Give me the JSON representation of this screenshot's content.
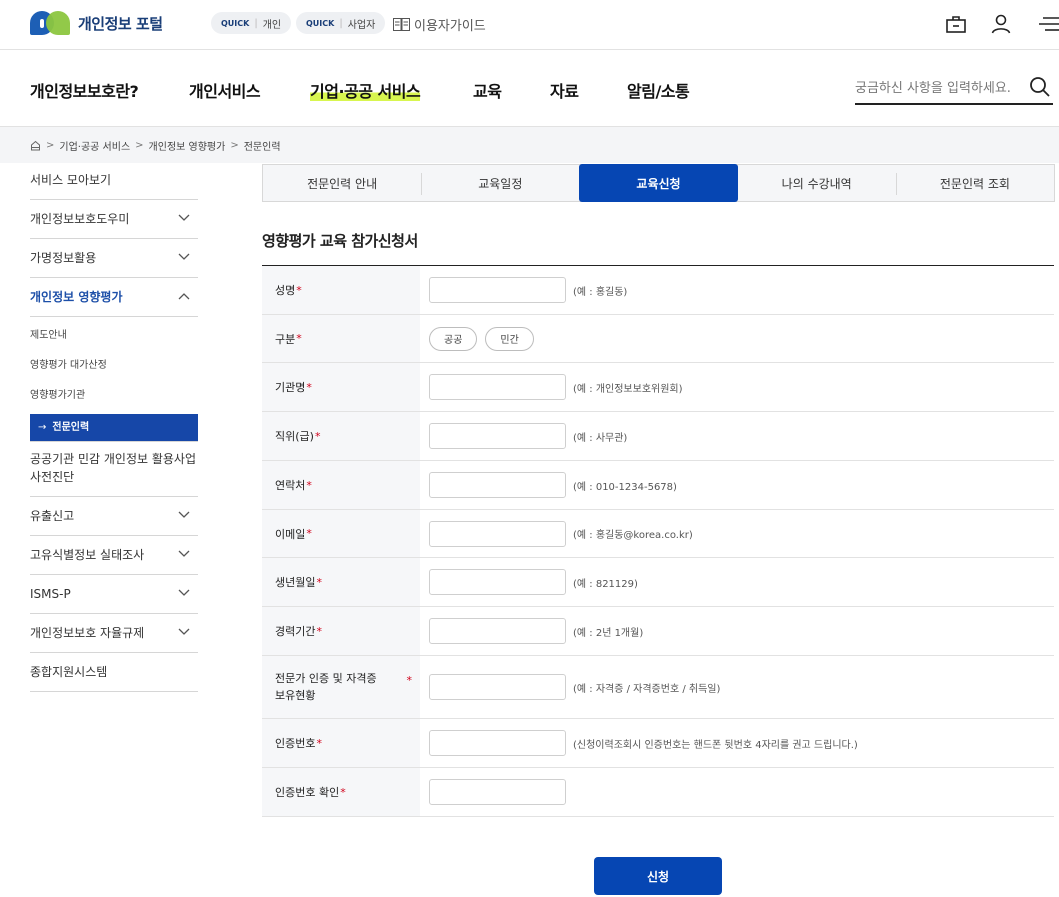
{
  "header": {
    "logo_text": "개인정보 포털",
    "quick_personal_tag": "QUICK",
    "quick_personal_label": "개인",
    "quick_business_tag": "QUICK",
    "quick_business_label": "사업자",
    "guide_label": "이용자가이드"
  },
  "gnb": {
    "items": [
      {
        "label": "개인정보보호란?"
      },
      {
        "label": "개인서비스"
      },
      {
        "label": "기업·공공 서비스"
      },
      {
        "label": "교육"
      },
      {
        "label": "자료"
      },
      {
        "label": "알림/소통"
      }
    ],
    "active_index": 2,
    "search_placeholder": "궁금하신 사항을 입력하세요."
  },
  "breadcrumb": [
    "기업·공공 서비스",
    "개인정보 영향평가",
    "전문인력"
  ],
  "sidebar": {
    "items": [
      {
        "label": "서비스 모아보기"
      },
      {
        "label": "개인정보보호도우미"
      },
      {
        "label": "가명정보활용"
      },
      {
        "label": "개인정보 영향평가"
      },
      {
        "label": "공공기관 민감 개인정보 활용사업 사전진단"
      },
      {
        "label": "유출신고"
      },
      {
        "label": "고유식별정보 실태조사"
      },
      {
        "label": "ISMS-P"
      },
      {
        "label": "개인정보보호 자율규제"
      },
      {
        "label": "종합지원시스템"
      }
    ],
    "sub_items": [
      {
        "label": "제도안내"
      },
      {
        "label": "영향평가 대가산정"
      },
      {
        "label": "영향평가기관"
      },
      {
        "label": "전문인력"
      }
    ],
    "active_arrow": "→"
  },
  "tabs": [
    {
      "label": "전문인력 안내"
    },
    {
      "label": "교육일정"
    },
    {
      "label": "교육신청"
    },
    {
      "label": "나의 수강내역"
    },
    {
      "label": "전문인력 조회"
    }
  ],
  "form": {
    "title": "영향평가 교육 참가신청서",
    "required_mark": "*",
    "fields": [
      {
        "label": "성명",
        "hint": "(예 : 홍길동)",
        "value": ""
      },
      {
        "label": "구분",
        "options": [
          "공공",
          "민간"
        ]
      },
      {
        "label": "기관명",
        "hint": "(예 : 개인정보보호위원회)",
        "value": ""
      },
      {
        "label": "직위(급)",
        "hint": "(예 : 사무관)",
        "value": ""
      },
      {
        "label": "연락처",
        "hint": "(예 : 010-1234-5678)",
        "value": ""
      },
      {
        "label": "이메일",
        "hint": "(예 : 홍길동@korea.co.kr)",
        "value": ""
      },
      {
        "label": "생년월일",
        "hint": "(예 : 821129)",
        "value": ""
      },
      {
        "label": "경력기간",
        "hint": "(예 : 2년 1개월)",
        "value": ""
      },
      {
        "label_line1": "전문가 인증 및 자격증",
        "label_line2": "보유현황",
        "hint": "(예 : 자격증 / 자격증번호 / 취득일)",
        "value": ""
      },
      {
        "label": "인증번호",
        "hint": "(신청이력조회시 인증번호는 핸드폰 뒷번호 4자리를 권고 드립니다.)",
        "value": ""
      },
      {
        "label": "인증번호 확인",
        "value": ""
      }
    ],
    "submit_label": "신청"
  },
  "colors": {
    "primary": "#0646b3",
    "sidebar_active_bg": "#1647a8",
    "highlight": "#d8f64f",
    "required": "#d0021b"
  }
}
